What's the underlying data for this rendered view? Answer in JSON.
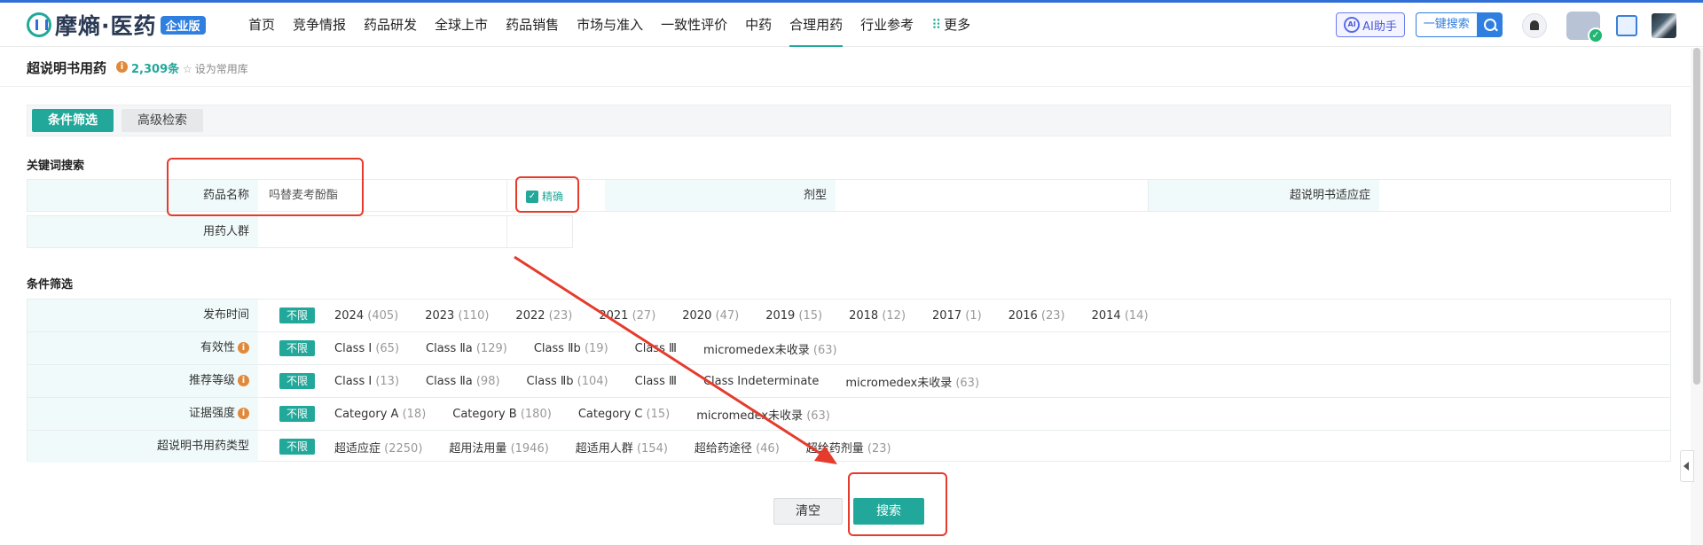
{
  "brand": {
    "name": "摩熵·医药",
    "badge": "企业版"
  },
  "nav": [
    "首页",
    "竞争情报",
    "药品研发",
    "全球上市",
    "药品销售",
    "市场与准入",
    "一致性评价",
    "中药",
    "合理用药",
    "行业参考",
    "更多"
  ],
  "nav_active": "合理用药",
  "header_tools": {
    "ai": "AI助手",
    "ai_icon_text": "AI",
    "one_search": "一键搜索",
    "vip_check": "✓"
  },
  "page": {
    "title": "超说明书用药",
    "info": "i",
    "count": "2,309条",
    "favorite": "设为常用库"
  },
  "tabs": {
    "filter": "条件筛选",
    "advanced": "高级检索"
  },
  "keyword": {
    "section": "关键词搜索",
    "drug_name_label": "药品名称",
    "drug_name_value": "吗替麦考酚酯",
    "exact_label": "精确",
    "exact_check": "✓",
    "dosage_label": "剂型",
    "indication_label": "超说明书适应症",
    "population_label": "用药人群"
  },
  "filters": {
    "section": "条件筛选",
    "all_label": "不限",
    "rows": [
      {
        "label": "发布时间",
        "info": "",
        "options": [
          [
            "2024",
            "(405)"
          ],
          [
            "2023",
            "(110)"
          ],
          [
            "2022",
            "(23)"
          ],
          [
            "2021",
            "(27)"
          ],
          [
            "2020",
            "(47)"
          ],
          [
            "2019",
            "(15)"
          ],
          [
            "2018",
            "(12)"
          ],
          [
            "2017",
            "(1)"
          ],
          [
            "2016",
            "(23)"
          ],
          [
            "2014",
            "(14)"
          ]
        ]
      },
      {
        "label": "有效性",
        "info": "i",
        "options": [
          [
            "Class Ⅰ",
            "(65)"
          ],
          [
            "Class Ⅱa",
            "(129)"
          ],
          [
            "Class Ⅱb",
            "(19)"
          ],
          [
            "Class Ⅲ",
            ""
          ],
          [
            "micromedex未收录",
            "(63)"
          ]
        ]
      },
      {
        "label": "推荐等级",
        "info": "i",
        "options": [
          [
            "Class Ⅰ",
            "(13)"
          ],
          [
            "Class Ⅱa",
            "(98)"
          ],
          [
            "Class Ⅱb",
            "(104)"
          ],
          [
            "Class Ⅲ",
            ""
          ],
          [
            "Class Indeterminate",
            ""
          ],
          [
            "micromedex未收录",
            "(63)"
          ]
        ]
      },
      {
        "label": "证据强度",
        "info": "i",
        "options": [
          [
            "Category A",
            "(18)"
          ],
          [
            "Category B",
            "(180)"
          ],
          [
            "Category C",
            "(15)"
          ],
          [
            "micromedex未收录",
            "(63)"
          ]
        ]
      },
      {
        "label": "超说明书用药类型",
        "info": "",
        "options": [
          [
            "超适应症",
            "(2250)"
          ],
          [
            "超用法用量",
            "(1946)"
          ],
          [
            "超适用人群",
            "(154)"
          ],
          [
            "超给药途径",
            "(46)"
          ],
          [
            "超给药剂量",
            "(23)"
          ]
        ]
      }
    ]
  },
  "buttons": {
    "clear": "清空",
    "search": "搜索"
  },
  "colors": {
    "accent": "#22a89a",
    "brand_blue": "#2f7fe0",
    "annotation_red": "#e53b2c"
  }
}
